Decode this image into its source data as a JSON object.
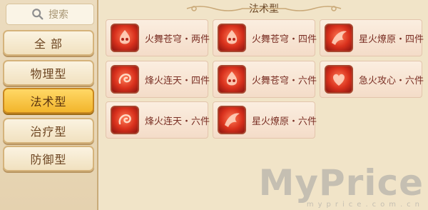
{
  "search": {
    "label": "搜索",
    "icon": "search-icon"
  },
  "sidebar": {
    "categories": [
      {
        "label": "全 部",
        "active": false
      },
      {
        "label": "物理型",
        "active": false
      },
      {
        "label": "法术型",
        "active": true
      },
      {
        "label": "治疗型",
        "active": false
      },
      {
        "label": "防御型",
        "active": false
      }
    ]
  },
  "main": {
    "title": "法术型",
    "items": [
      {
        "label": "火舞苍穹・两件",
        "icon": "flame-mask-icon"
      },
      {
        "label": "火舞苍穹・四件",
        "icon": "flame-mask-icon"
      },
      {
        "label": "星火燎原・四件",
        "icon": "phoenix-icon"
      },
      {
        "label": "烽火连天・四件",
        "icon": "swirl-flame-icon"
      },
      {
        "label": "火舞苍穹・六件",
        "icon": "flame-mask-icon"
      },
      {
        "label": "急火攻心・六件",
        "icon": "heart-flame-icon"
      },
      {
        "label": "烽火连天・六件",
        "icon": "swirl-flame-icon"
      },
      {
        "label": "星火燎原・六件",
        "icon": "phoenix-icon"
      }
    ]
  },
  "watermark": {
    "big": "MyPrice",
    "small": "myprice.com.cn"
  },
  "colors": {
    "active_tab": "#f2b52c",
    "item_text": "#7a2f24",
    "background": "#f1e4c8"
  }
}
